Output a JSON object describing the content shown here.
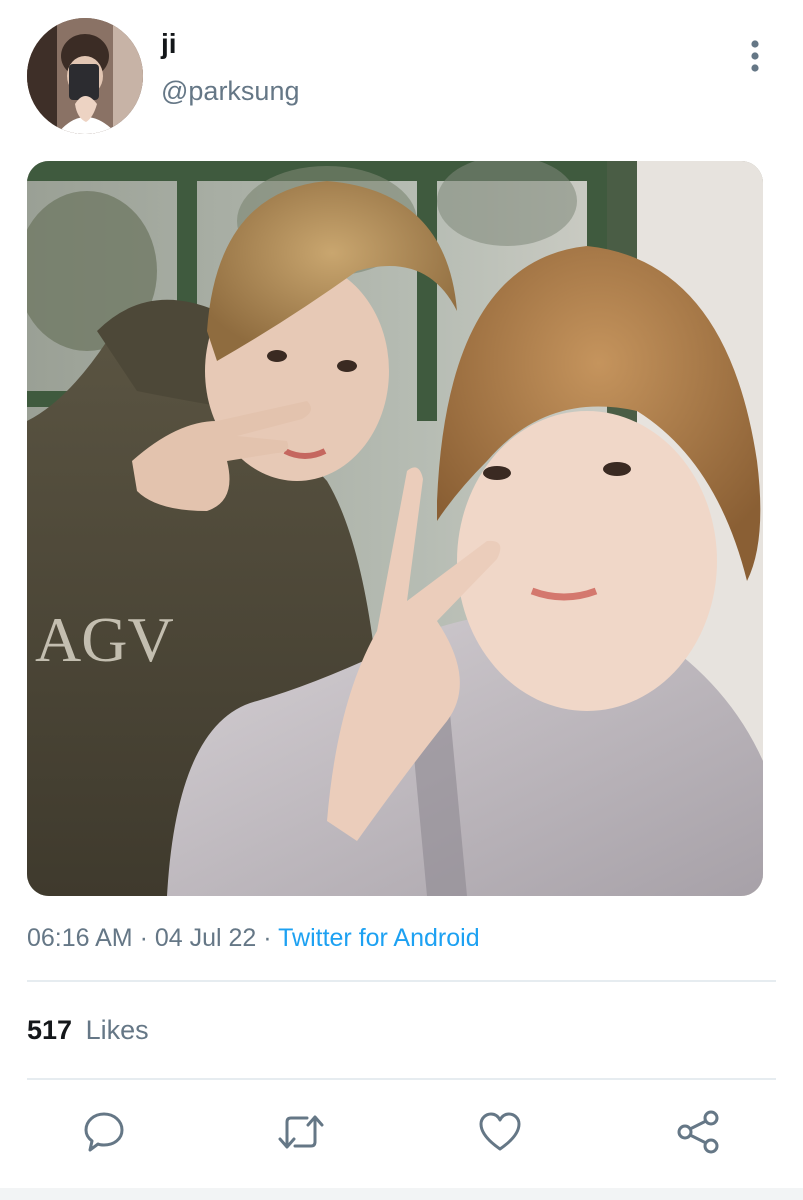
{
  "tweet": {
    "author": {
      "display_name": "ji",
      "handle": "@parksung"
    },
    "timestamp": "06:16 AM",
    "date": "04 Jul 22",
    "separator": "·",
    "source": "Twitter for Android",
    "likes": {
      "count": "517",
      "label": "Likes"
    }
  },
  "icons": {
    "more": "more-vertical-icon",
    "reply": "reply-icon",
    "retweet": "retweet-icon",
    "like": "heart-icon",
    "share": "share-icon"
  },
  "colors": {
    "text": "#14171a",
    "secondary_text": "#657786",
    "link": "#1da1f2",
    "divider": "#e6ecf0",
    "icon": "#657786"
  }
}
